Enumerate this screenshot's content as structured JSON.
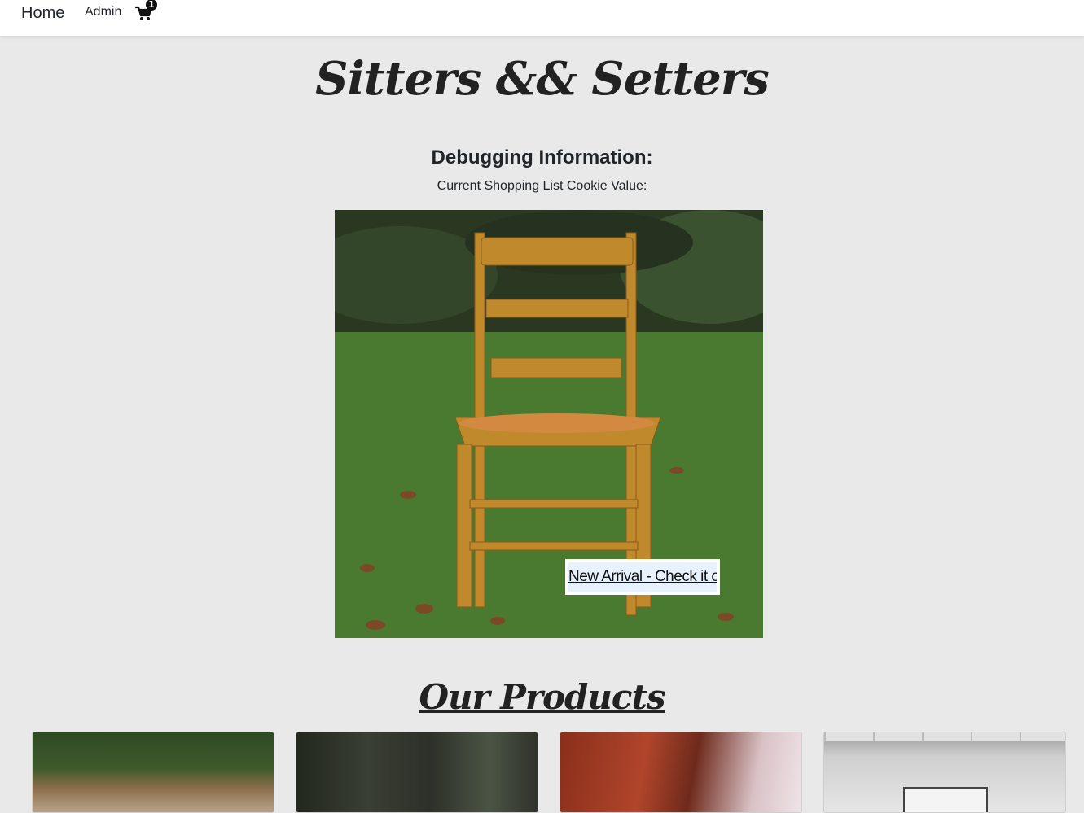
{
  "nav": {
    "home": "Home",
    "admin": "Admin",
    "cart_icon": "shopping-cart-icon",
    "cart_count": "1"
  },
  "header": {
    "title": "Sitters && Setters"
  },
  "debug": {
    "title": "Debugging Information:",
    "cookie_label": "Current Shopping List Cookie Value:"
  },
  "hero": {
    "image": "chair-on-grass",
    "badge_text": "New Arrival - Check it out!"
  },
  "products": {
    "title": "Our Products",
    "items": [
      {
        "image": "forest-clearing"
      },
      {
        "image": "dark-forest-trees"
      },
      {
        "image": "autumn-red-tree"
      },
      {
        "image": "white-gallery-room"
      }
    ]
  },
  "colors": {
    "background": "#e9e9e9",
    "navbar": "#ffffff",
    "text": "#212529",
    "badge_bg": "#e8f2ff"
  }
}
